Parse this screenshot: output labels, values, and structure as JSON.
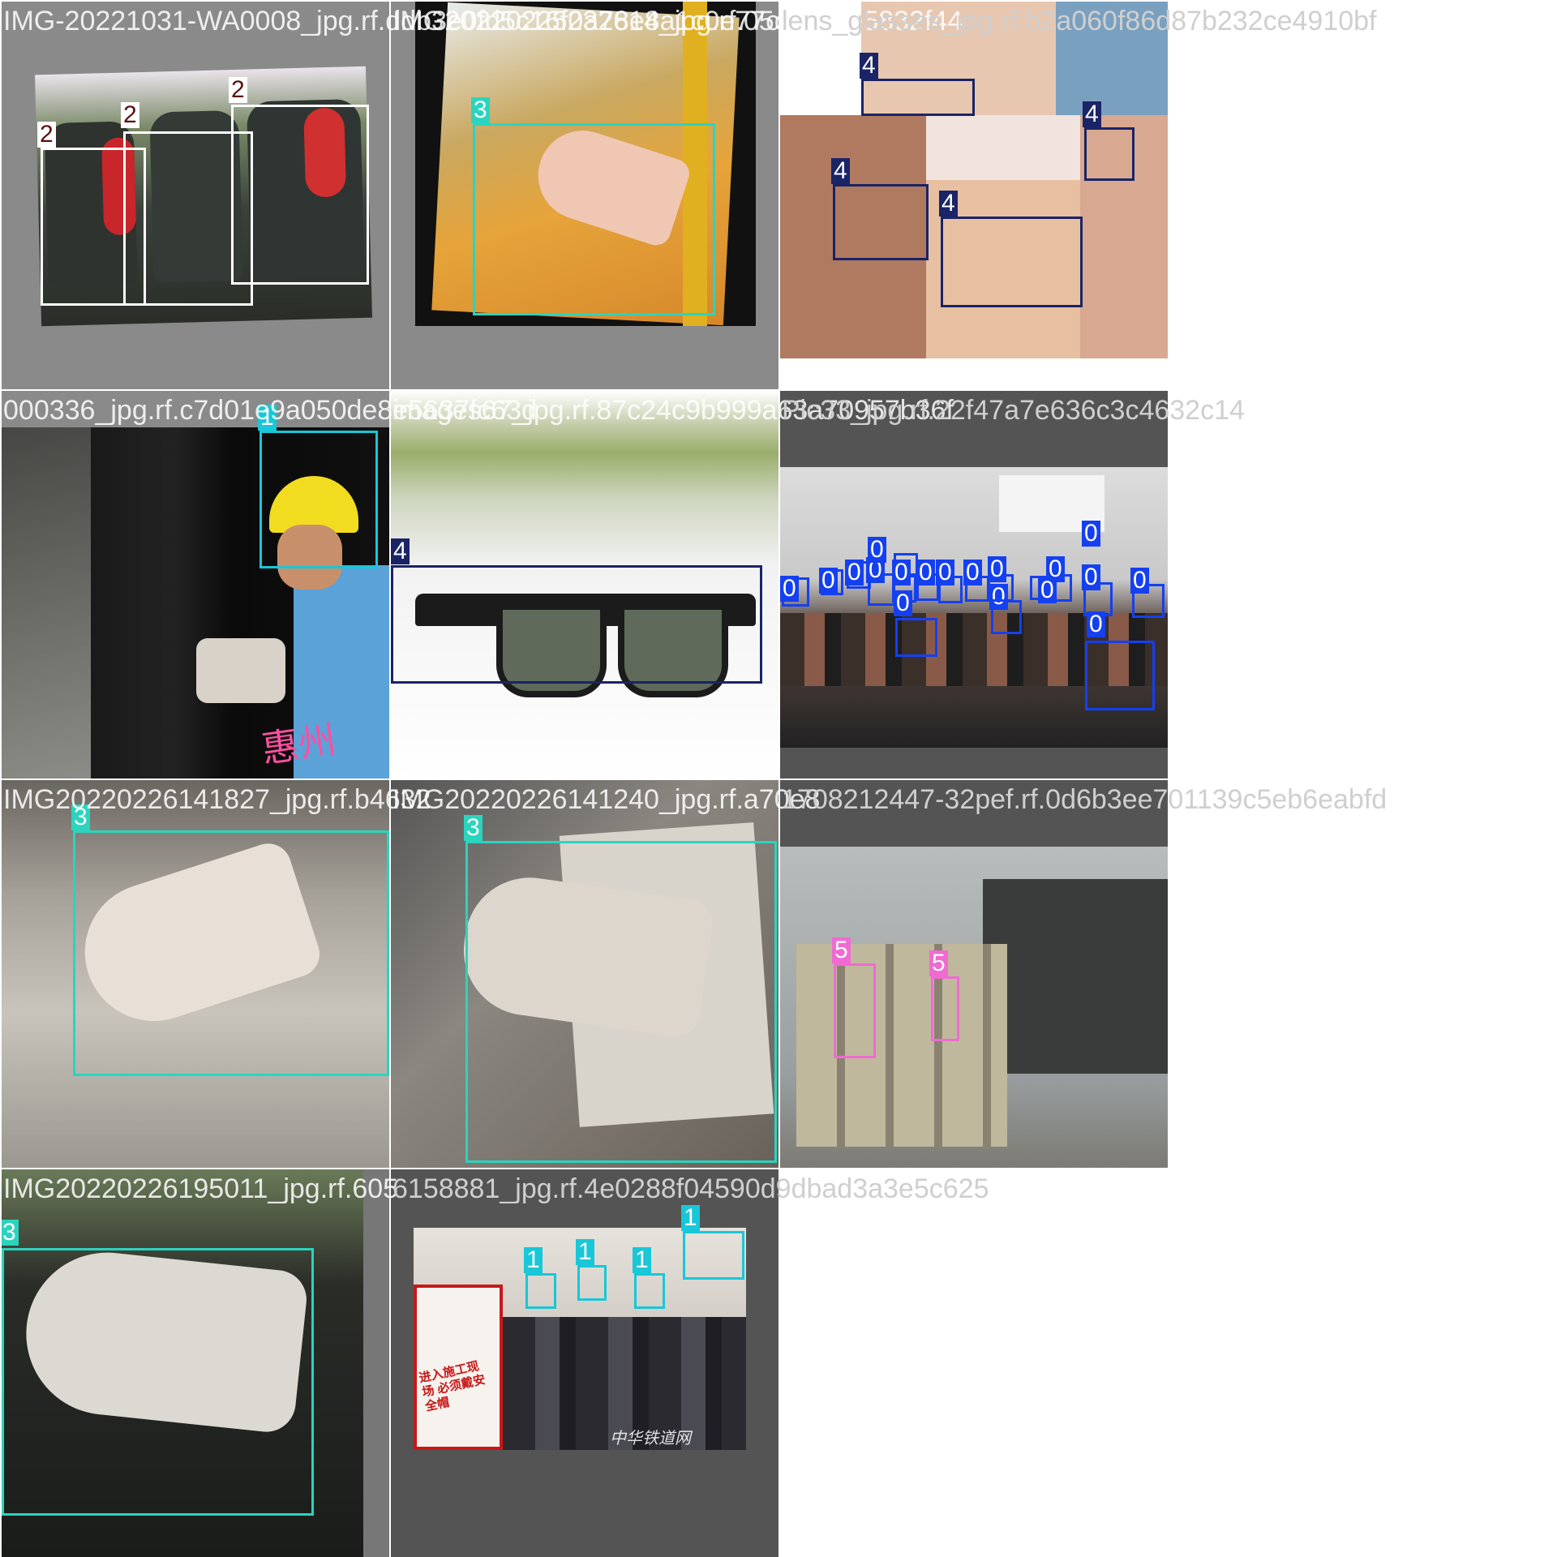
{
  "tiles": [
    {
      "filename": "IMG-20221031-WA0008_jpg.rf.ddb3e0fd5c16f0a78e8a1c0e77cd0bc6",
      "labels": [
        "2",
        "2",
        "2"
      ]
    },
    {
      "filename": "IMG20220225232614_jpg.rf.05cdcb7e5832f44",
      "labels": [
        "3"
      ]
    },
    {
      "filename": "lens_glasses_jpg.rf.b2a060f86d87b232ce4910bf",
      "labels": [
        "4",
        "4",
        "4",
        "4"
      ]
    },
    {
      "filename": "000336_jpg.rf.c7d01e9a050de8e5637fc63d",
      "labels": [
        "1"
      ]
    },
    {
      "filename": "images67_jpg.rf.87c24c9b999a63a70957b36f",
      "labels": [
        "4"
      ]
    },
    {
      "filename": "Pic33_jpg.rf.22f47a7e636c3c4632c14",
      "labels": [
        "0",
        "0",
        "0",
        "0",
        "0",
        "0",
        "0",
        "0",
        "0",
        "0",
        "0",
        "0",
        "0",
        "0",
        "0",
        "0",
        "0",
        "0"
      ]
    },
    {
      "filename": "IMG20220226141827_jpg.rf.b4632",
      "labels": [
        "3"
      ]
    },
    {
      "filename": "IMG20220226141240_jpg.rf.a70e8",
      "labels": [
        "3"
      ]
    },
    {
      "filename": "1708212447-32pef.rf.0d6b3ee701139c5eb6eabfd",
      "labels": [
        "5",
        "5"
      ]
    },
    {
      "filename": "IMG20220226195011_jpg.rf.605",
      "labels": [
        "3"
      ]
    },
    {
      "filename": "6158881_jpg.rf.4e0288f04590d9dbad3a3e5c625",
      "labels": [
        "1",
        "1",
        "1",
        "1"
      ]
    }
  ],
  "signs": {
    "worker_brand": "惠州",
    "safety_sign": "进入施工现场 必须戴安全帽",
    "watermark": "中华铁道网"
  },
  "colors": {
    "class_0": "#1540f0",
    "class_1": "#18c7d8",
    "class_2": "#ffffff",
    "class_3": "#2ad4be",
    "class_4": "#1a2466",
    "class_5": "#f06ad2"
  }
}
